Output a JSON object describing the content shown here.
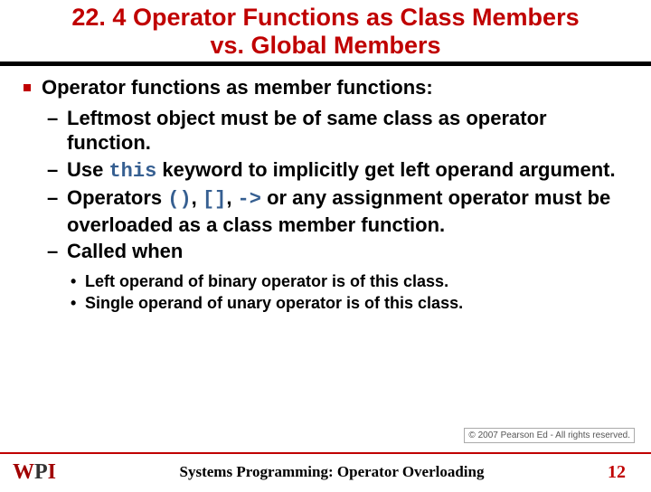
{
  "title_line1": "22. 4 Operator Functions as Class Members",
  "title_line2": "vs. Global Members",
  "heading": "Operator functions as member functions:",
  "sub": [
    {
      "pre": "Leftmost object must be of same class as operator function.",
      "code": "",
      "post": ""
    },
    {
      "pre": "Use ",
      "code": "this",
      "post": " keyword to implicitly get left operand argument."
    },
    {
      "pre": "Operators ",
      "codes": [
        "()",
        "[]",
        "->"
      ],
      "post": " or any assignment operator must be overloaded as a class member function."
    },
    {
      "pre": "Called when",
      "code": "",
      "post": ""
    }
  ],
  "subsub": [
    "Left operand of binary operator is of this class.",
    "Single operand of unary operator is of this class."
  ],
  "copyright": "© 2007 Pearson Ed - All rights reserved.",
  "footer_title": "Systems Programming:   Operator Overloading",
  "page_number": "12",
  "logo": {
    "w": "W",
    "p": "P",
    "i": "I"
  }
}
